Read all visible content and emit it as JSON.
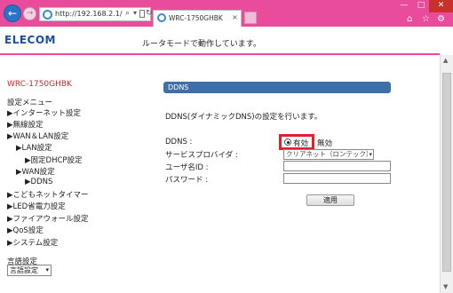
{
  "browser": {
    "url": "http://192.168.2.1/",
    "search_glyph": "⌕",
    "dropdown_glyph": "▾",
    "reload_glyph": "↻",
    "back_glyph": "←",
    "forward_glyph": "→",
    "tab_title": "WRC-1750GHBK",
    "tab_close": "×",
    "window_min": "—",
    "window_max": "□",
    "window_close": "✕",
    "home_glyph": "⌂",
    "star_glyph": "☆",
    "gear_glyph": "⚙"
  },
  "header": {
    "logo": "ELECOM",
    "mode_text": "ルータモードで動作しています。"
  },
  "sidebar": {
    "model": "WRC-1750GHBK",
    "menu_title": "設定メニュー",
    "items": [
      {
        "label": "▶インターネット設定"
      },
      {
        "label": "▶無線設定"
      },
      {
        "label": "▶WAN＆LAN設定"
      },
      {
        "label": "▶LAN設定"
      },
      {
        "label": "▶固定DHCP設定"
      },
      {
        "label": "▶WAN設定"
      },
      {
        "label": "▶DDNS"
      },
      {
        "label": "▶こどもネットタイマー"
      },
      {
        "label": "▶LED省電力設定"
      },
      {
        "label": "▶ファイアウォール設定"
      },
      {
        "label": "▶QoS設定"
      },
      {
        "label": "▶システム設定"
      }
    ],
    "language_title": "言語設定",
    "language_value": "言語設定",
    "language_arrow": "▾"
  },
  "main": {
    "section_title": "DDNS",
    "description": "DDNS(ダイナミックDNS)の設定を行います。",
    "ddns_label": "DDNS :",
    "radio_enabled": "有効",
    "radio_disabled": "無効",
    "provider_label": "サービスプロバイダ :",
    "provider_value": "クリアネット（ロンテック）",
    "provider_arrow": "▾",
    "username_label": "ユーザ名ID :",
    "password_label": "パスワード :",
    "apply_button": "適用"
  },
  "scrollbar": {
    "up": "▲",
    "down": "▼"
  },
  "colors": {
    "chrome": "#e84c9a",
    "logo": "#1a4f9c",
    "model": "#d8232a",
    "section_bar": "#3f6fa8",
    "highlight": "#e0202a"
  }
}
